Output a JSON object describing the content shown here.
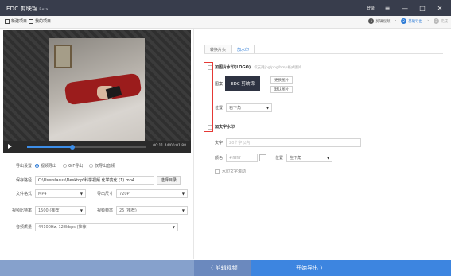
{
  "app": {
    "brand": "EDC 剪映锦",
    "edition": "Beta"
  },
  "titlebar": {
    "login": "登录",
    "menu_icon": "menu-icon",
    "minimize_icon": "minimize-icon",
    "maximize_icon": "maximize-icon",
    "close_icon": "close-icon"
  },
  "menubar": {
    "new_project": "新建项目",
    "my_projects": "我的项目"
  },
  "steps": [
    {
      "num": "1",
      "label": "剪辑视频"
    },
    {
      "num": "2",
      "label": "基础导出"
    },
    {
      "num": "3",
      "label": "完成"
    }
  ],
  "player": {
    "time": "00:11.44/00:01.88",
    "progress": 0.38
  },
  "export": {
    "mode_label": "导出设置",
    "modes": [
      "视频导出",
      "GIF导出",
      "仅导出音频"
    ],
    "selected_mode": 0,
    "path_label": "保存路径",
    "path_value": "C:\\Users\\asus\\Desktop\\科学视频 化学变化 (1).mp4",
    "path_button": "选择目录",
    "format_label": "文件格式",
    "format_value": "MP4",
    "size_label": "导出尺寸",
    "size_value": "720P",
    "bitrate_label": "视频比特率",
    "bitrate_value": "1500 (推荐)",
    "framerate_label": "视频帧率",
    "framerate_value": "25 (推荐)",
    "audio_label": "音频质量",
    "audio_value": "44100Hz, 128kbps (推荐)"
  },
  "tabs": [
    {
      "label": "转换片头"
    },
    {
      "label": "加水印"
    }
  ],
  "watermark": {
    "image_label": "加图片水印(LOGO)",
    "image_hint": "仅支持jpg/png/bmp格式图片",
    "pattern_label": "图案",
    "logo_text": "EDC 剪映锦",
    "change_btn": "更换图片",
    "default_btn": "默认图片",
    "pos_label": "位置",
    "pos_value": "右下角",
    "text_label": "加文字水印",
    "text_field_label": "文字",
    "text_placeholder": "20个字以内",
    "color_label": "颜色",
    "color_value": "#ffffff",
    "text_pos_label": "位置",
    "text_pos_value": "左下角",
    "scroll_label": "水印文字滚动"
  },
  "footer": {
    "back": "〈 剪辑视频",
    "next": "开始导出 〉"
  }
}
